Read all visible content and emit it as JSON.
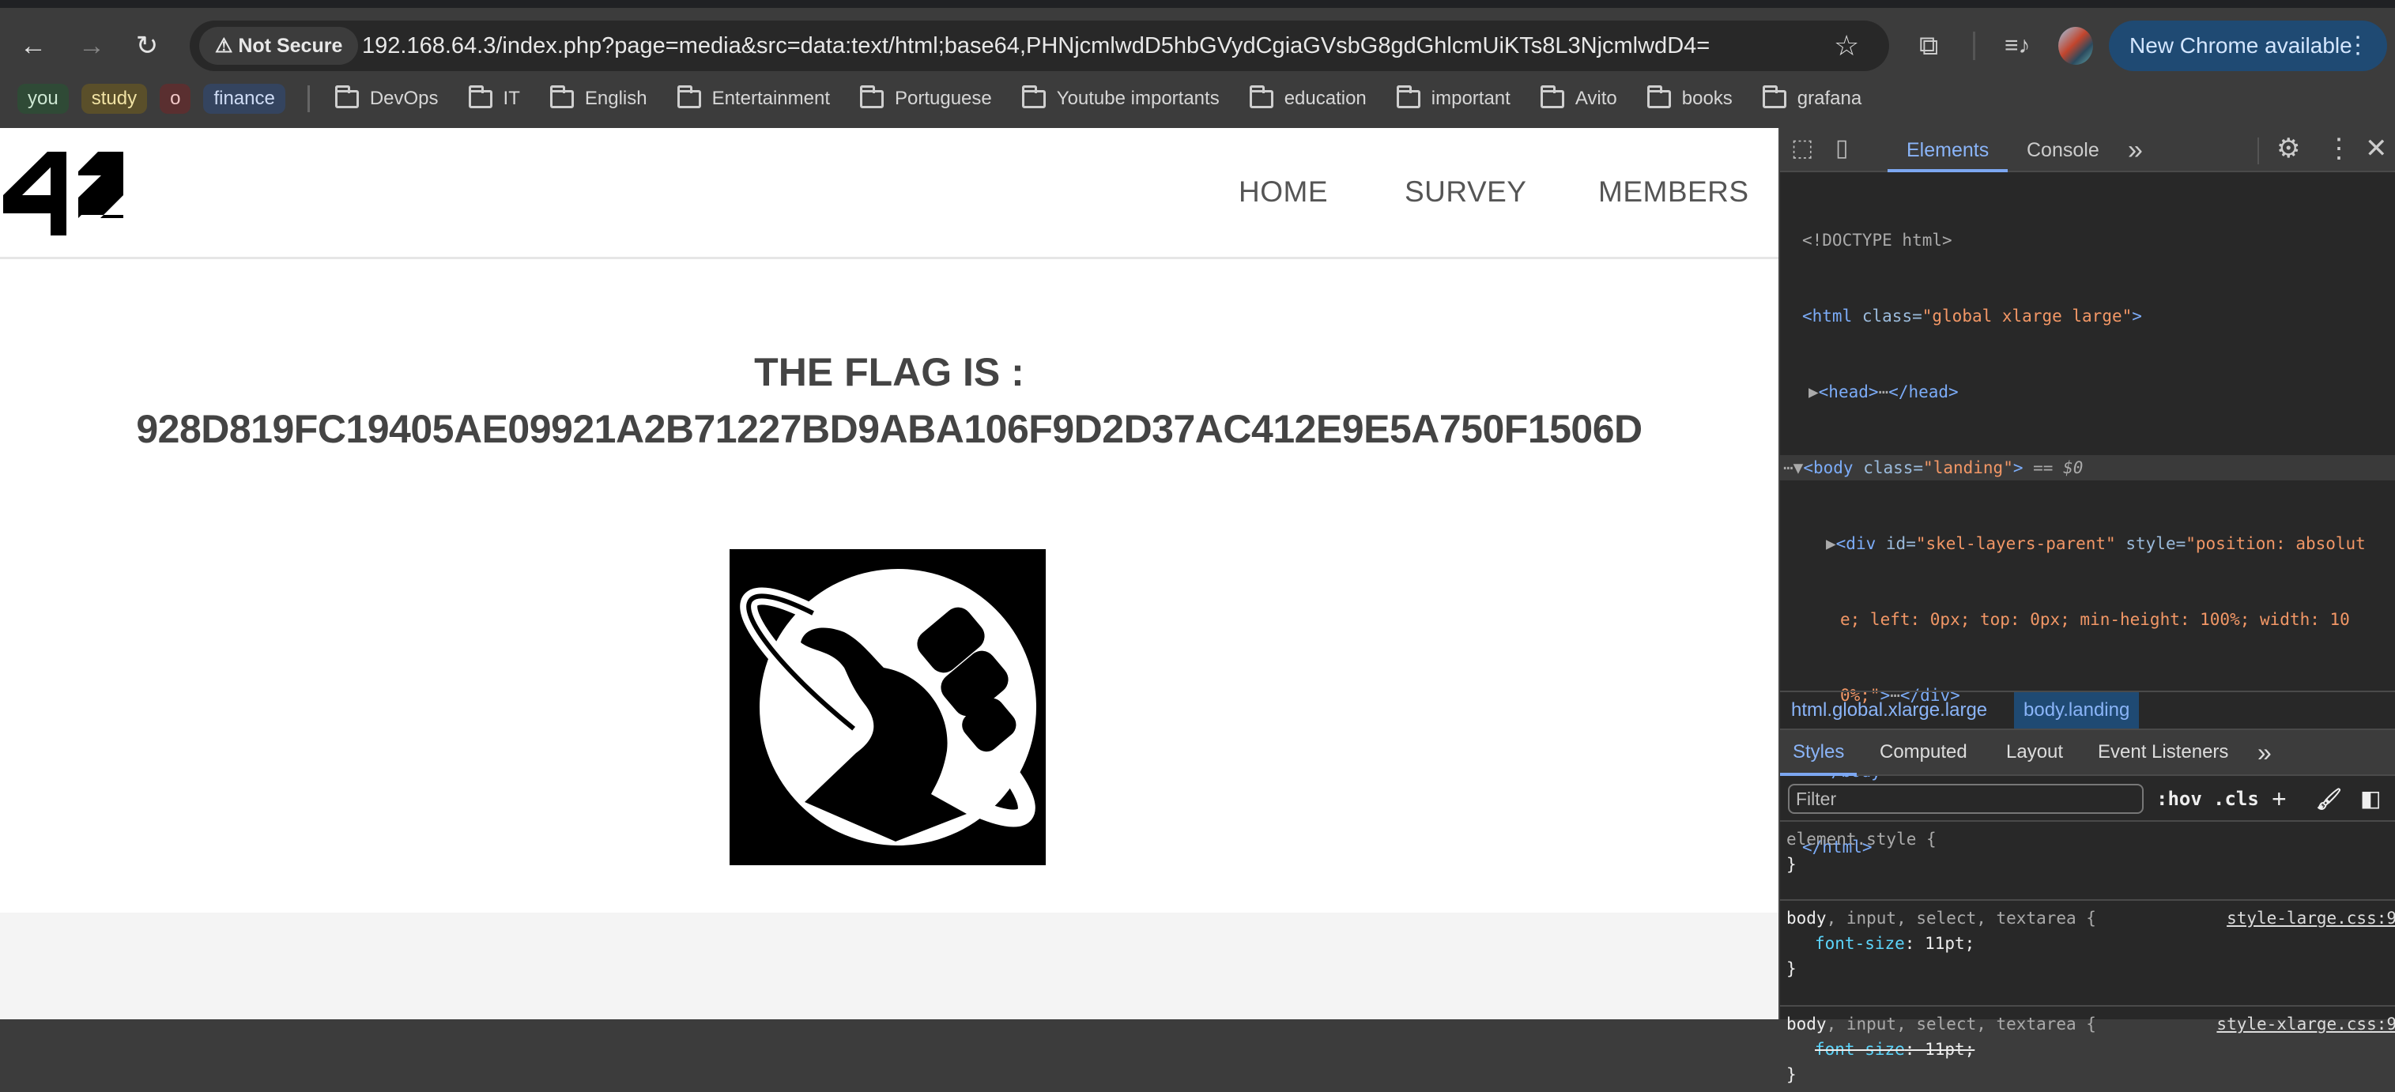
{
  "browser": {
    "back_icon": "arrow-left-icon",
    "forward_icon": "arrow-right-icon",
    "reload_icon": "reload-icon",
    "security_label": "Not Secure",
    "url": "192.168.64.3/index.php?page=media&src=data:text/html;base64,PHNjcmlwdD5hbGVydCgiaGVsbG8gdGhlcmUiKTs8L3NjcmlwdD4=",
    "new_chrome_label": "New Chrome available",
    "bookmark_chips": [
      {
        "label": "you",
        "bg": "#2f4a36",
        "fg": "#cfe8d4"
      },
      {
        "label": "study",
        "bg": "#5a4f2a",
        "fg": "#f1e3a4"
      },
      {
        "label": "o",
        "bg": "#5a2f30",
        "fg": "#f2c8c8"
      },
      {
        "label": "finance",
        "bg": "#34445f",
        "fg": "#cfdcf5"
      }
    ],
    "bookmark_folders": [
      "DevOps",
      "IT",
      "English",
      "Entertainment",
      "Portuguese",
      "Youtube importants",
      "education",
      "important",
      "Avito",
      "books",
      "grafana"
    ]
  },
  "site": {
    "logo_text": "42",
    "nav": [
      "HOME",
      "SURVEY",
      "MEMBERS"
    ],
    "flag_title": "THE FLAG IS :",
    "flag_value": "928D819FC19405AE09921A2B71227BD9ABA106F9D2D37AC412E9E5A750F1506D"
  },
  "devtools": {
    "tabs": [
      "Elements",
      "Console"
    ],
    "more": "»",
    "tree": {
      "doctype": "<!DOCTYPE html>",
      "html_open": "<html",
      "html_attr": "class",
      "html_class": "\"global xlarge large\"",
      "head": "<head>",
      "head_close": "</head>",
      "body_open": "<body",
      "body_class": "\"landing\"",
      "body_ref": "== $0",
      "div_open": "<div",
      "div_id_attr": "id",
      "div_id": "\"skel-layers-parent\"",
      "div_style_attr": "style",
      "div_style_1": "\"position: absolut",
      "div_style_2": "e; left: 0px; top: 0px; min-height: 100%; width: 10",
      "div_style_3": "0%;\"",
      "div_close": "</div>",
      "body_close": "</body>",
      "html_close": "</html>"
    },
    "breadcrumbs": [
      "html.global.xlarge.large",
      "body.landing"
    ],
    "style_tabs": [
      "Styles",
      "Computed",
      "Layout",
      "Event Listeners"
    ],
    "filter_placeholder": "Filter",
    "hov": ":hov",
    "cls": ".cls",
    "rules": [
      {
        "selector": "element.style {",
        "close": "}"
      },
      {
        "selector_main": "body",
        "selector_rest": ", input, select, textarea {",
        "source": "style-large.css:9",
        "prop": "font-size",
        "value": ": 11pt;",
        "close": "}"
      },
      {
        "selector_main": "body",
        "selector_rest": ", input, select, textarea {",
        "source": "style-xlarge.css:9",
        "prop": "font-size",
        "value": ": 11pt;",
        "close": "}"
      }
    ]
  }
}
